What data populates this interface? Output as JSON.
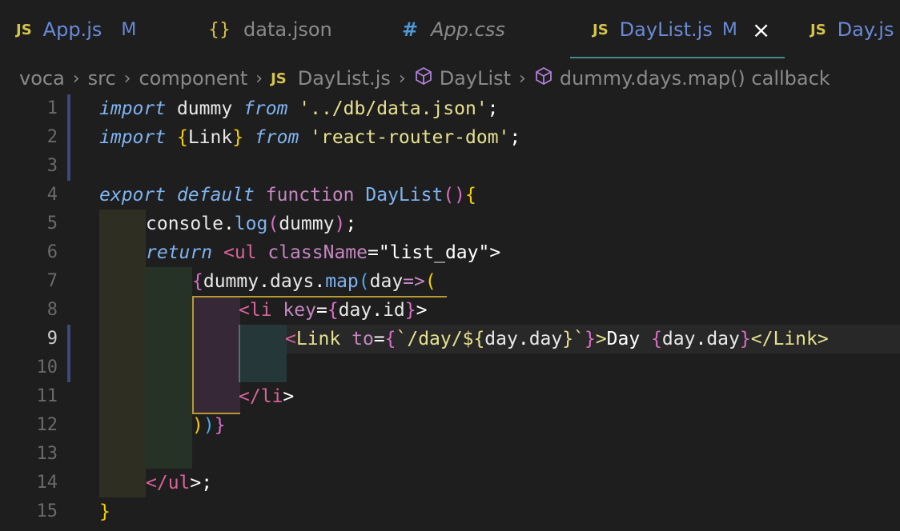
{
  "tabs": [
    {
      "icon": "JS",
      "name": "App.js",
      "status": "M"
    },
    {
      "icon": "{}",
      "name": "data.json",
      "status": ""
    },
    {
      "icon": "#",
      "name": "App.css",
      "status": ""
    },
    {
      "icon": "JS",
      "name": "DayList.js",
      "status": "M",
      "close": "×",
      "active": true
    },
    {
      "icon": "JS",
      "name": "Day.js",
      "status": ""
    }
  ],
  "breadcrumb": {
    "items": [
      "voca",
      "src",
      "component"
    ],
    "file_icon": "JS",
    "file": "DayList.js",
    "symbol": "DayList",
    "callback": "dummy.days.map() callback"
  },
  "line_numbers": [
    "1",
    "2",
    "3",
    "4",
    "5",
    "6",
    "7",
    "8",
    "9",
    "10",
    "11",
    "12",
    "13",
    "14",
    "15"
  ],
  "code": {
    "l1": {
      "a": "import",
      "b": " dummy ",
      "c": "from",
      "d": " '../db/data.json'",
      "e": ";"
    },
    "l2": {
      "a": "import",
      "b": " ",
      "c": "{",
      "d": "Link",
      "e": "}",
      "f": " ",
      "g": "from",
      "h": " 'react-router-dom'",
      "i": ";"
    },
    "l4": {
      "a": "export",
      "b": " ",
      "c": "default",
      "d": " ",
      "e": "function",
      "f": " DayList",
      "g": "()",
      "h": "{"
    },
    "l5": {
      "a": "console",
      "b": ".",
      "c": "log",
      "d": "(",
      "e": "dummy",
      "f": ")",
      "g": ";"
    },
    "l6": {
      "a": "return",
      "b": " ",
      "c": "<",
      "d": "ul",
      "e": " className",
      "f": "=",
      "g": "\"list_day\"",
      "h": ">"
    },
    "l7": {
      "a": "{",
      "b": "dummy",
      "c": ".",
      "d": "days",
      "e": ".",
      "f": "map",
      "g": "(",
      "h": "day",
      "i": "=>",
      "j": "("
    },
    "l8": {
      "a": "<",
      "b": "li",
      "c": " key",
      "d": "=",
      "e": "{",
      "f": "day",
      "g": ".",
      "h": "id",
      "i": "}",
      "j": ">"
    },
    "l9": {
      "a": "<",
      "b": "Link",
      "c": " to",
      "d": "=",
      "e": "{",
      "f": "`/day/${",
      "g": "day",
      "h": ".",
      "i": "day",
      "j": "}`",
      "k": "}",
      "l": ">",
      "m": "Day ",
      "n": "{",
      "o": "day",
      "p": ".",
      "q": "day",
      "r": "}",
      "s": "</",
      "t": "Link",
      "u": ">"
    },
    "l11": {
      "a": "</",
      "b": "li",
      "c": ">"
    },
    "l12": {
      "a": ")",
      "b": ")",
      "c": "}"
    },
    "l14": {
      "a": "</",
      "b": "ul",
      "c": ">",
      "d": ";"
    },
    "l15": {
      "a": "}"
    }
  },
  "colors": {
    "background": "#1e1e1e",
    "accent": "#6a8ad8",
    "js_icon": "#d7c44a"
  }
}
